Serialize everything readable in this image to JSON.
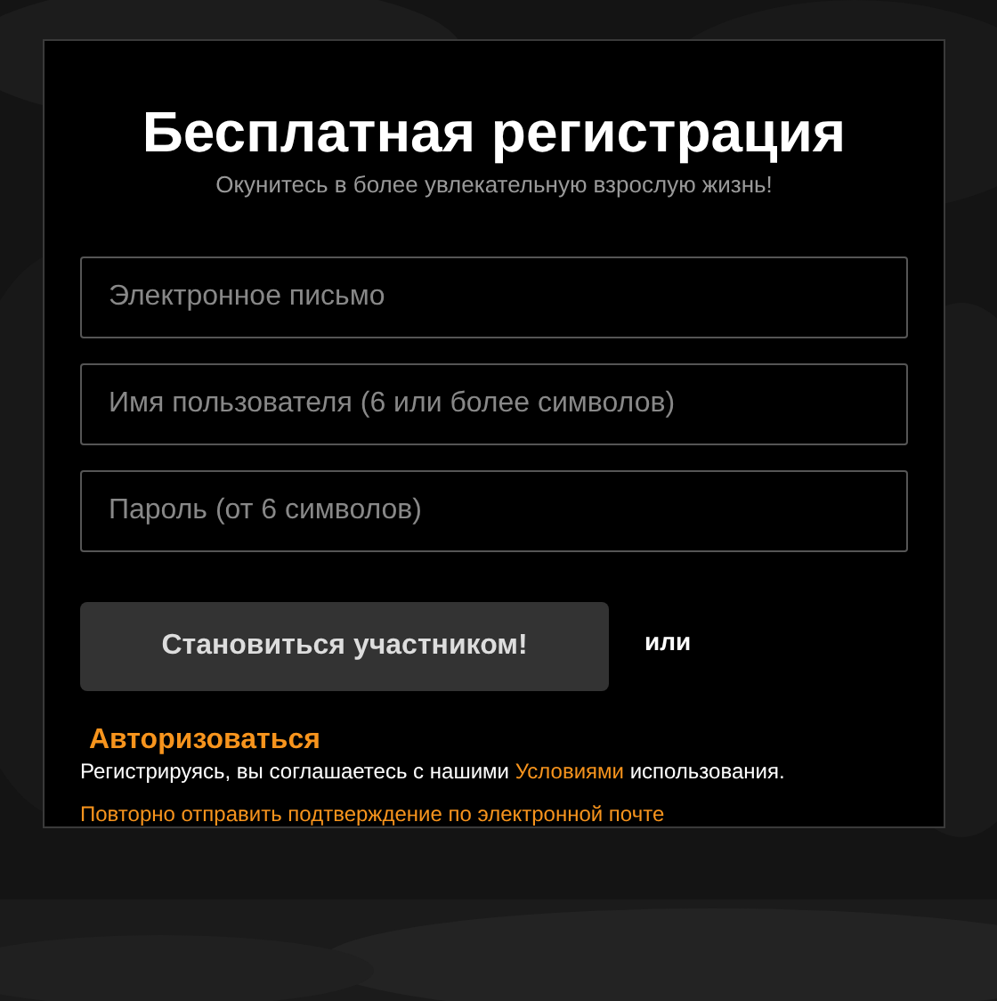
{
  "title": "Бесплатная регистрация",
  "subtitle": "Окунитесь в более увлекательную взрослую жизнь!",
  "fields": [
    {
      "placeholder": "Электронное письмо"
    },
    {
      "placeholder": "Имя пользователя (6 или более символов)"
    },
    {
      "placeholder": "Пароль (от 6 символов)"
    }
  ],
  "submit_button": "Становиться участником!",
  "or_text": "или",
  "login_link": "Авторизоваться",
  "terms": {
    "before": "Регистрируясь, вы соглашаетесь с нашими",
    "link": "Условиями",
    "after": "использования."
  },
  "resend_link": "Повторно отправить подтверждение по электронной почте"
}
